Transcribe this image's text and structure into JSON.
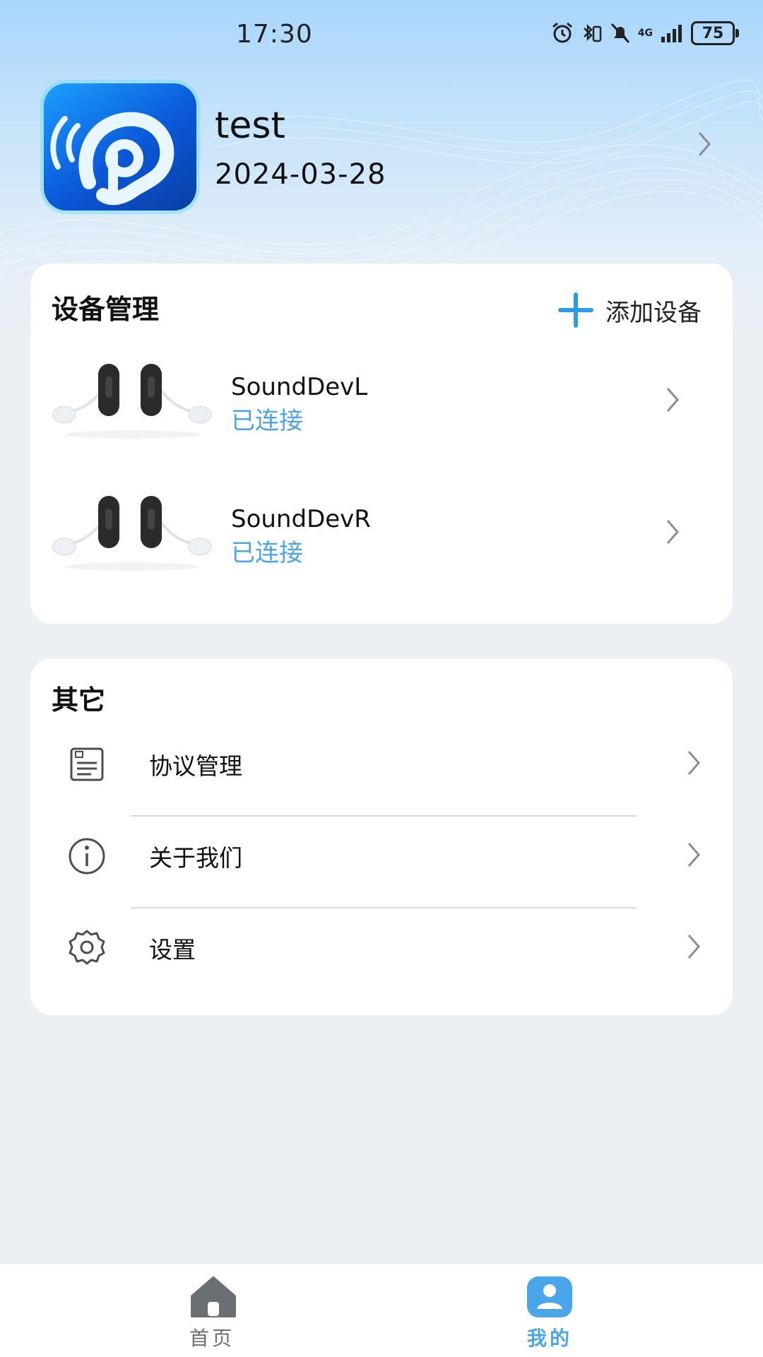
{
  "status_bar": {
    "time": "17:30",
    "network": "4G",
    "battery": "75"
  },
  "profile": {
    "name": "test",
    "date": "2024-03-28"
  },
  "device_section": {
    "title": "设备管理",
    "add_label": "添加设备",
    "devices": [
      {
        "name": "SoundDevL",
        "status": "已连接"
      },
      {
        "name": "SoundDevR",
        "status": "已连接"
      }
    ]
  },
  "other_section": {
    "title": "其它",
    "items": [
      {
        "label": "协议管理",
        "icon": "agreement-icon"
      },
      {
        "label": "关于我们",
        "icon": "info-icon"
      },
      {
        "label": "设置",
        "icon": "settings-gear-icon"
      }
    ]
  },
  "tabbar": {
    "tabs": [
      {
        "label": "首页",
        "icon": "home-icon",
        "active": false
      },
      {
        "label": "我的",
        "icon": "profile-icon",
        "active": true
      }
    ]
  },
  "colors": {
    "accent": "#4aa6ea",
    "tab_active": "#4aa6ea",
    "tab_inactive": "#6b6e72",
    "background": "#eceff4"
  }
}
